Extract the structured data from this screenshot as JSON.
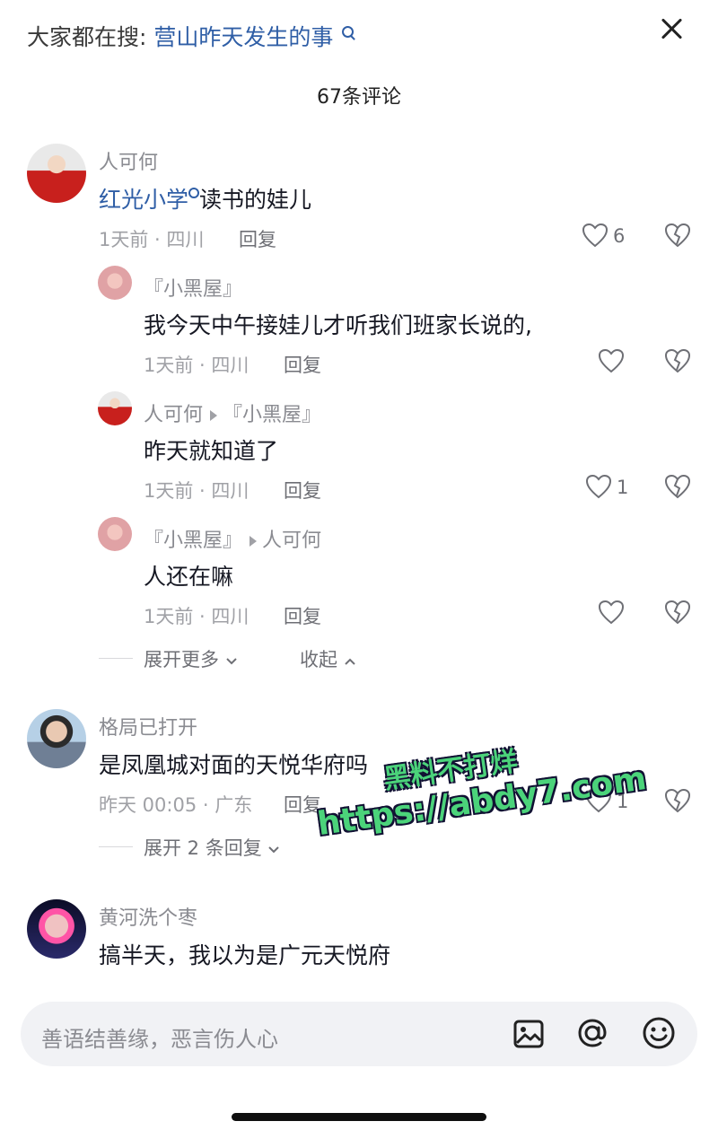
{
  "header": {
    "trending_label": "大家都在搜:",
    "trending_query": "营山昨天发生的事",
    "comment_count": "67条评论"
  },
  "comments": [
    {
      "user": "人可何",
      "text_link": "红光小学",
      "text": "读书的娃儿",
      "time": "1天前 · 四川",
      "reply": "回复",
      "likes": "6",
      "replies": [
        {
          "user": "『小黑屋』",
          "reply_to": "",
          "text": "我今天中午接娃儿才听我们班家长说的,",
          "time": "1天前 · 四川",
          "reply": "回复",
          "likes": ""
        },
        {
          "user": "人可何",
          "reply_to": "『小黑屋』",
          "text": "昨天就知道了",
          "time": "1天前 · 四川",
          "reply": "回复",
          "likes": "1"
        },
        {
          "user": "『小黑屋』",
          "reply_to": "人可何",
          "text": "人还在嘛",
          "time": "1天前 · 四川",
          "reply": "回复",
          "likes": ""
        }
      ],
      "expand_more": "展开更多",
      "collapse": "收起"
    },
    {
      "user": "格局已打开",
      "text": "是凤凰城对面的天悦华府吗",
      "time": "昨天 00:05 · 广东",
      "reply": "回复",
      "likes": "1",
      "expand_replies": "展开 2 条回复"
    },
    {
      "user": "黄河洗个枣",
      "text": "搞半天，我以为是广元天悦府"
    }
  ],
  "input": {
    "placeholder": "善语结善缘，恶言伤人心"
  },
  "watermark": {
    "line1": "黑料不打烊",
    "line2": "https://abdy7.com"
  }
}
